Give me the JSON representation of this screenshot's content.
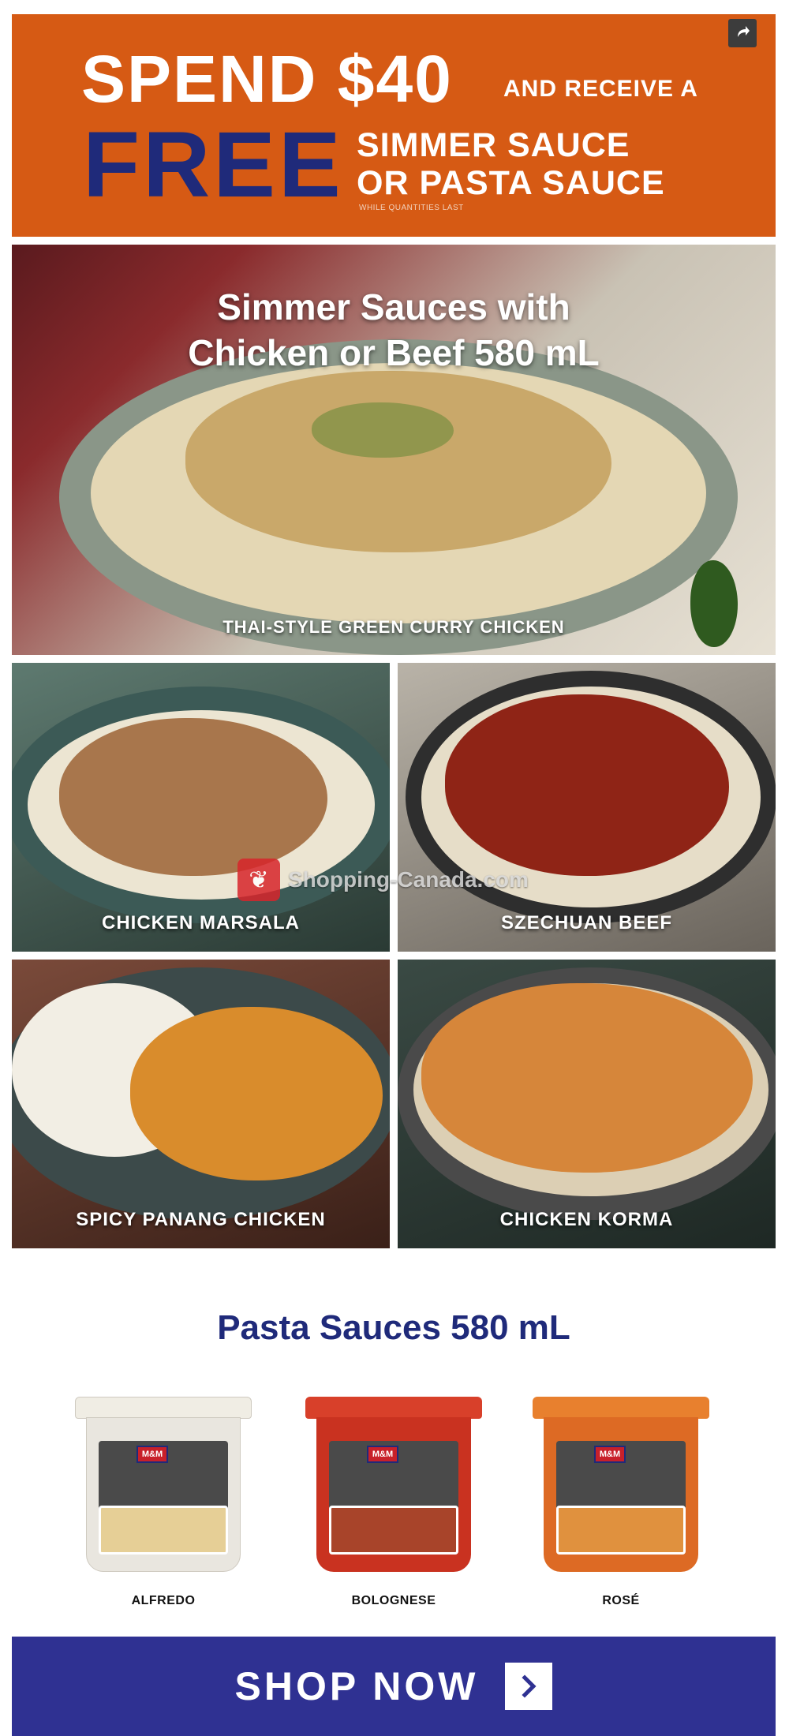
{
  "promo": {
    "spend": "SPEND $40",
    "receive": "AND RECEIVE A",
    "free": "FREE",
    "offer_line1": "SIMMER SAUCE",
    "offer_line2": "OR PASTA SAUCE",
    "fine_print": "WHILE QUANTITIES LAST",
    "share_icon": "share-icon"
  },
  "hero": {
    "headline_line1": "Simmer Sauces with",
    "headline_line2": "Chicken or Beef 580 mL",
    "caption": "THAI-STYLE GREEN CURRY CHICKEN"
  },
  "dishes": [
    {
      "caption": "CHICKEN MARSALA"
    },
    {
      "caption": "SZECHUAN BEEF"
    },
    {
      "caption": "SPICY PANANG CHICKEN"
    },
    {
      "caption": "CHICKEN KORMA"
    }
  ],
  "watermark": {
    "text": "Shopping-Canada.com"
  },
  "pasta": {
    "title": "Pasta Sauces 580 mL",
    "brand": "M&M",
    "jars": [
      {
        "name": "ALFREDO",
        "lid_color": "#f0ede4",
        "body_color": "#e9e6df"
      },
      {
        "name": "BOLOGNESE",
        "lid_color": "#d8402a",
        "body_color": "#c93220"
      },
      {
        "name": "ROSÉ",
        "lid_color": "#e8802e",
        "body_color": "#dd6a24"
      }
    ]
  },
  "cta": {
    "label": "SHOP NOW",
    "arrow_icon": "chevron-right-icon"
  },
  "colors": {
    "promo_bg": "#d65a14",
    "brand_blue": "#1f2a7a",
    "cta_bg": "#2f3192"
  }
}
